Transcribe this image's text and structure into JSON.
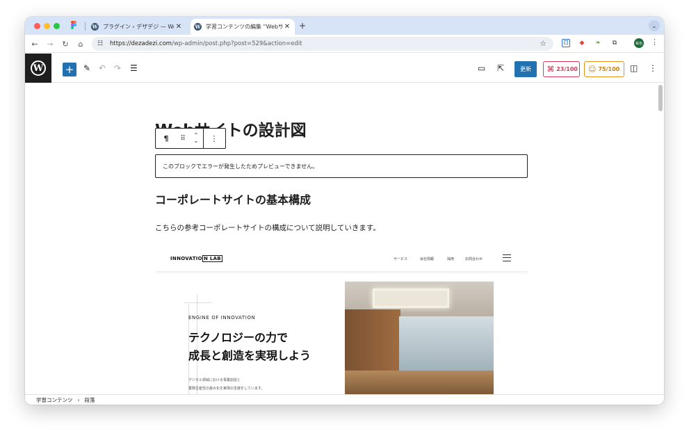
{
  "browser": {
    "tabs": [
      {
        "title": "プラグイン ‹ デザデジ — WordPress",
        "active": false
      },
      {
        "title": "学習コンテンツの編集 “Webサイトの設計図”",
        "active": true
      }
    ],
    "new_tab": "+",
    "tab_close": "✕",
    "url_domain": "https://dezadezi.com",
    "url_path": "/wp-admin/post.php?post=529&action=edit",
    "profile_initials": "祐也"
  },
  "editor": {
    "update_label": "更新",
    "seo_score": "23/100",
    "readability_score": "75/100",
    "colors": {
      "update": "#2271b1",
      "seo": "#d9375b",
      "readability": "#e69319"
    }
  },
  "content": {
    "post_title": "Webサイトの設計図",
    "error_message": "このブロックでエラーが発生したためプレビューできません。",
    "heading": "コーポレートサイトの基本構成",
    "paragraph": "こちらの参考コーポレートサイトの構成について説明していきます。",
    "mockup": {
      "logo_main": "INNOVATIO",
      "logo_boxed": "N LAB",
      "menu": [
        "サービス",
        "会社情報",
        "採用",
        "お問合わせ"
      ],
      "eyebrow": "ENGINE OF INNOVATION",
      "headline_line1": "テクノロジーの力で",
      "headline_line2": "成長と創造を実現しよう",
      "sub_line1": "デジタル領域における事業創造と",
      "sub_line2": "業務生産性の最大化を実現の支援をしています。"
    }
  },
  "footer": {
    "crumbs": [
      "学習コンテンツ",
      "段落"
    ],
    "separator": "›"
  }
}
